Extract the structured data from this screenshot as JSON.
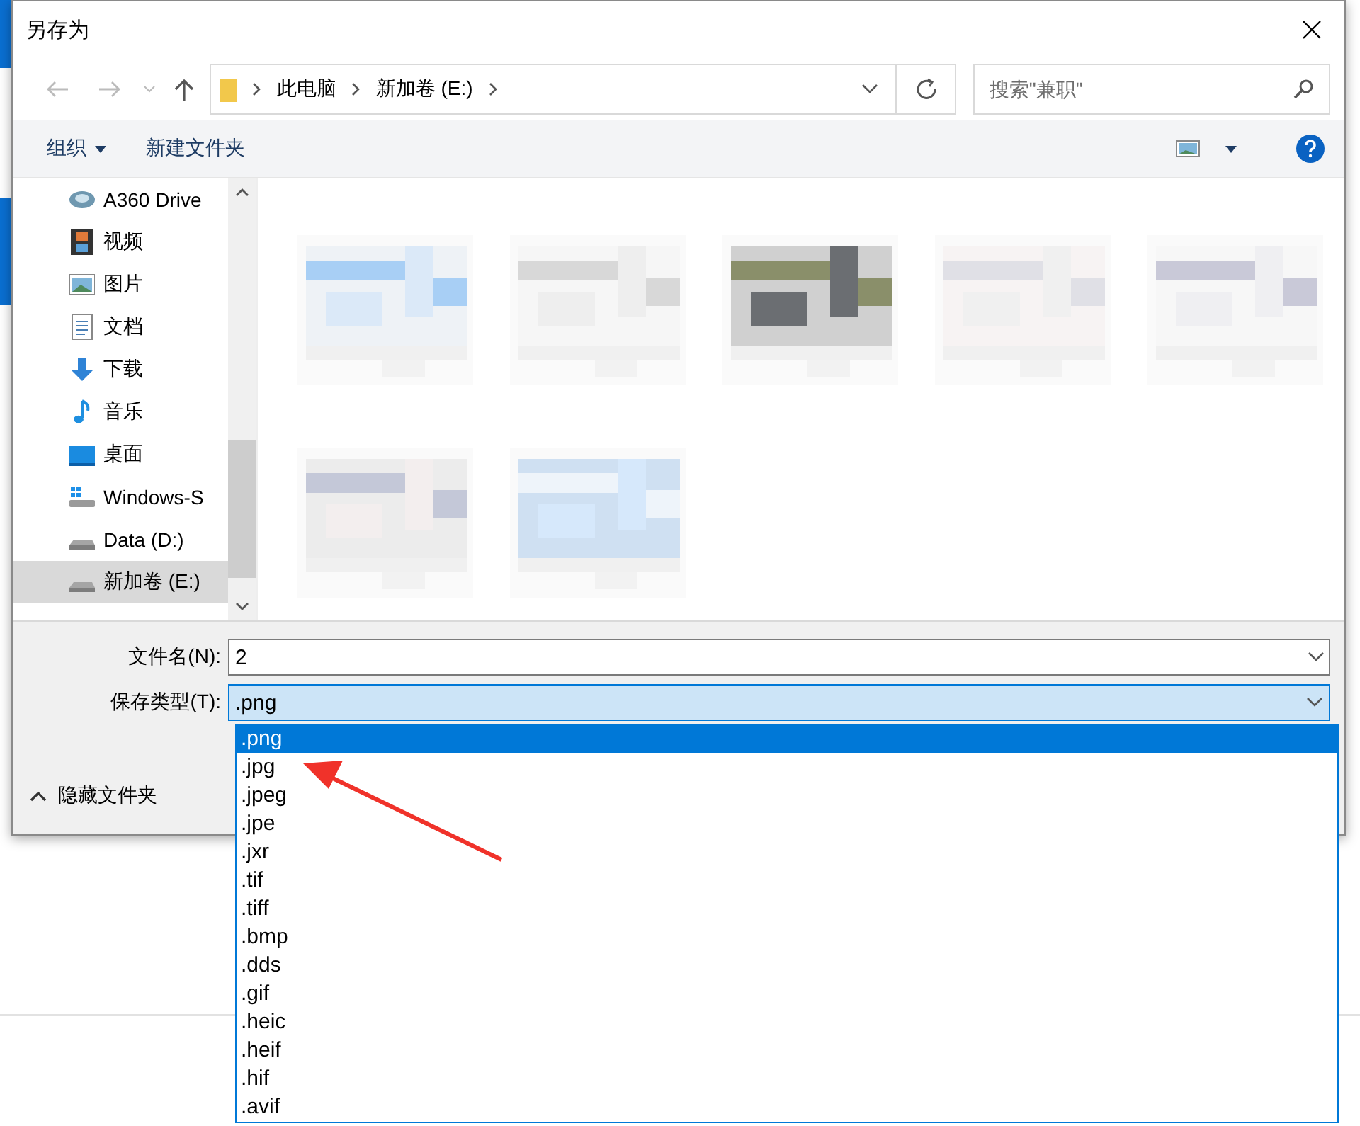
{
  "window": {
    "title": "另存为"
  },
  "address_bar": {
    "path": [
      "此电脑",
      "新加卷 (E:)"
    ]
  },
  "search": {
    "placeholder": "搜索\"兼职\""
  },
  "toolbar": {
    "organize": "组织",
    "new_folder": "新建文件夹"
  },
  "sidebar": {
    "items": [
      {
        "label": "A360 Drive",
        "kind": "cloud",
        "selected": false
      },
      {
        "label": "视频",
        "kind": "video",
        "selected": false
      },
      {
        "label": "图片",
        "kind": "pictures",
        "selected": false
      },
      {
        "label": "文档",
        "kind": "documents",
        "selected": false
      },
      {
        "label": "下载",
        "kind": "downloads",
        "selected": false
      },
      {
        "label": "音乐",
        "kind": "music",
        "selected": false
      },
      {
        "label": "桌面",
        "kind": "desktop",
        "selected": false
      },
      {
        "label": "Windows-S",
        "kind": "system-drive",
        "selected": false
      },
      {
        "label": "Data (D:)",
        "kind": "drive",
        "selected": false
      },
      {
        "label": "新加卷 (E:)",
        "kind": "drive",
        "selected": true
      }
    ]
  },
  "file_name": {
    "label": "文件名(N):",
    "value": "2"
  },
  "save_type": {
    "label": "保存类型(T):",
    "value": ".png",
    "options": [
      {
        "label": ".png",
        "selected": true
      },
      {
        "label": ".jpg",
        "selected": false
      },
      {
        "label": ".jpeg",
        "selected": false
      },
      {
        "label": ".jpe",
        "selected": false
      },
      {
        "label": ".jxr",
        "selected": false
      },
      {
        "label": ".tif",
        "selected": false
      },
      {
        "label": ".tiff",
        "selected": false
      },
      {
        "label": ".bmp",
        "selected": false
      },
      {
        "label": ".dds",
        "selected": false
      },
      {
        "label": ".gif",
        "selected": false
      },
      {
        "label": ".heic",
        "selected": false
      },
      {
        "label": ".heif",
        "selected": false
      },
      {
        "label": ".hif",
        "selected": false
      },
      {
        "label": ".avif",
        "selected": false
      }
    ]
  },
  "hide_folders": {
    "label": "隐藏文件夹"
  }
}
